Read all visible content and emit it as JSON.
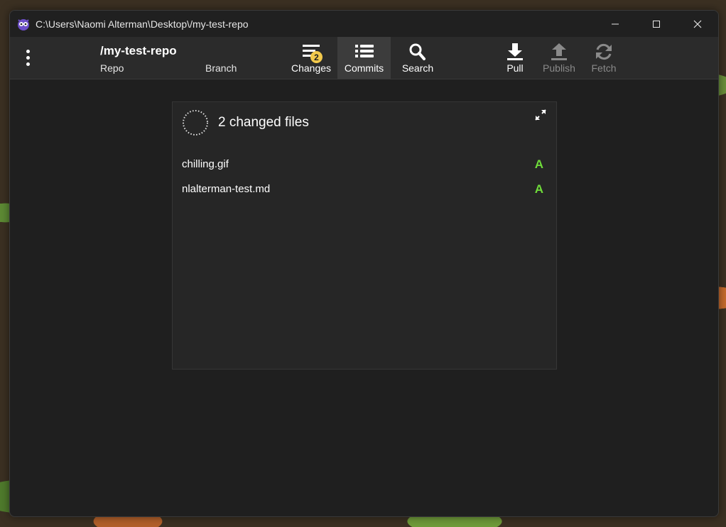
{
  "window": {
    "title": "C:\\Users\\Naomi Alterman\\Desktop\\/my-test-repo",
    "icon": "app-owl-icon"
  },
  "toolbar": {
    "repo_name": "/my-test-repo",
    "repo_label": "Repo",
    "branch_label": "Branch",
    "changes_label": "Changes",
    "changes_count": "2",
    "commits_label": "Commits",
    "search_label": "Search",
    "pull_label": "Pull",
    "publish_label": "Publish",
    "fetch_label": "Fetch",
    "active_tab": "Commits"
  },
  "panel": {
    "title": "2 changed files",
    "files": [
      {
        "name": "chilling.gif",
        "status": "A"
      },
      {
        "name": "nlalterman-test.md",
        "status": "A"
      }
    ]
  },
  "colors": {
    "added": "#6fdc3a",
    "badge": "#f2c94c",
    "background": "#1f1f1f"
  }
}
